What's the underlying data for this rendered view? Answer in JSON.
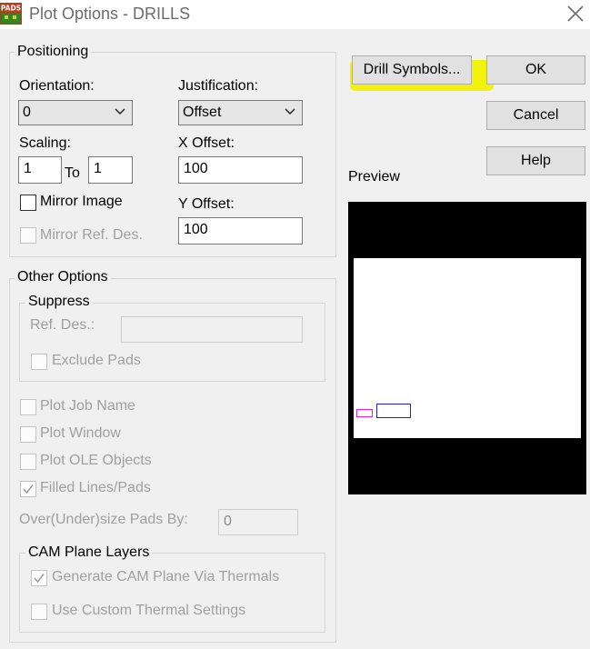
{
  "window": {
    "app_icon_text": "PADS",
    "title": "Plot Options - DRILLS"
  },
  "positioning": {
    "legend": "Positioning",
    "orientation_label": "Orientation:",
    "orientation_value": "0",
    "justification_label": "Justification:",
    "justification_value": "Offset",
    "scaling_label": "Scaling:",
    "scale_from": "1",
    "to_label": "To",
    "scale_to": "1",
    "x_offset_label": "X Offset:",
    "x_offset_value": "100",
    "y_offset_label": "Y Offset:",
    "y_offset_value": "100",
    "mirror_image_label": "Mirror Image",
    "mirror_image_checked": false,
    "mirror_ref_label": "Mirror Ref. Des.",
    "mirror_ref_checked": false
  },
  "other_options": {
    "legend": "Other Options",
    "suppress": {
      "legend": "Suppress",
      "ref_des_label": "Ref. Des.:",
      "ref_des_value": "",
      "exclude_pads_label": "Exclude Pads"
    },
    "plot_job_name_label": "Plot Job Name",
    "plot_window_label": "Plot Window",
    "plot_ole_label": "Plot OLE Objects",
    "filled_lines_label": "Filled Lines/Pads",
    "filled_lines_checked": true,
    "oversize_label": "Over(Under)size Pads By:",
    "oversize_value": "0",
    "cam_plane": {
      "legend": "CAM Plane Layers",
      "generate_label": "Generate CAM Plane Via Thermals",
      "generate_checked": true,
      "custom_thermal_label": "Use Custom Thermal Settings",
      "custom_thermal_checked": false
    }
  },
  "buttons": {
    "drill_symbols": "Drill Symbols...",
    "ok": "OK",
    "cancel": "Cancel",
    "help": "Help"
  },
  "preview": {
    "label": "Preview"
  },
  "colors": {
    "highlight": "#f2f20c",
    "preview_bg": "#000000",
    "preview_page": "#ffffff",
    "magenta_marker": "#e020e0",
    "blue_marker": "#2020d0"
  },
  "icons": [
    "pads-app-icon",
    "close-icon",
    "chevron-down-icon",
    "checkmark-icon"
  ]
}
